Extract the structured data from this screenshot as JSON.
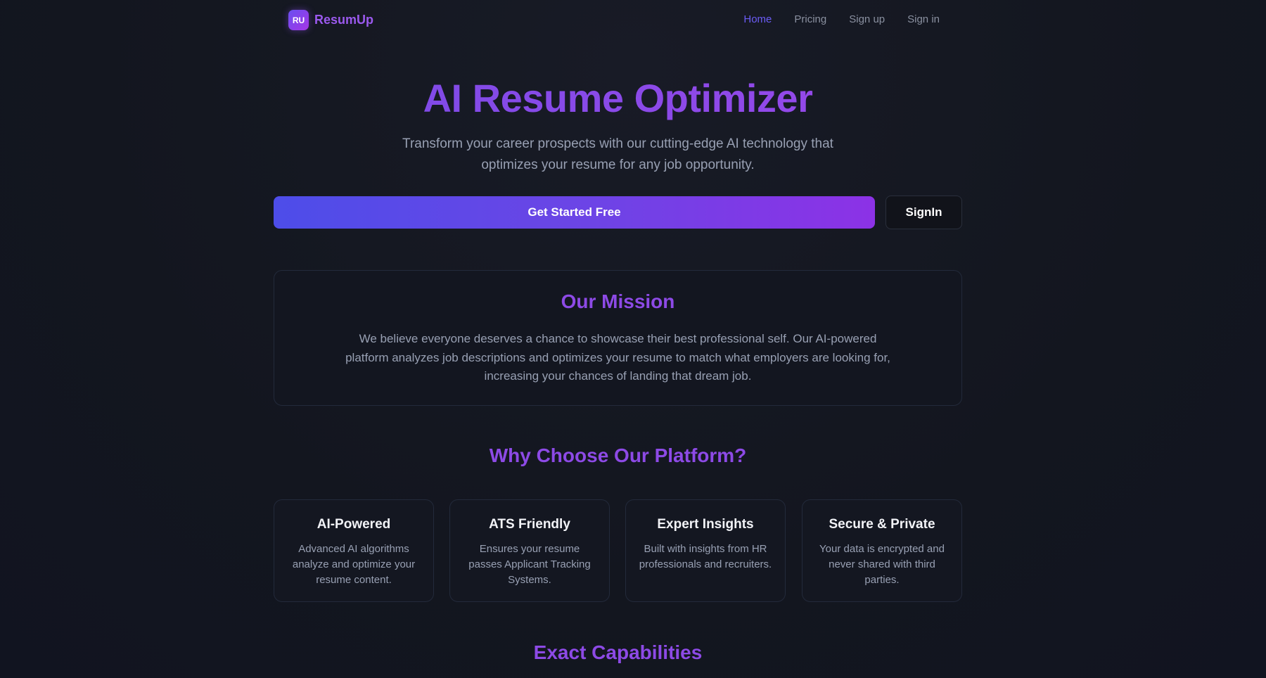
{
  "nav": {
    "logo_badge": "RU",
    "logo_text": "ResumUp",
    "links": [
      {
        "label": "Home",
        "active": true
      },
      {
        "label": "Pricing",
        "active": false
      },
      {
        "label": "Sign up",
        "active": false
      },
      {
        "label": "Sign in",
        "active": false
      }
    ]
  },
  "hero": {
    "title": "AI Resume Optimizer",
    "subtitle": "Transform your career prospects with our cutting-edge AI technology that optimizes your resume for any job opportunity.",
    "primary_button": "Get Started Free",
    "secondary_button": "SignIn"
  },
  "mission": {
    "title": "Our Mission",
    "text": "We believe everyone deserves a chance to showcase their best professional self. Our AI-powered platform analyzes job descriptions and optimizes your resume to match what employers are looking for, increasing your chances of landing that dream job."
  },
  "why": {
    "title": "Why Choose Our Platform?",
    "features": [
      {
        "title": "AI-Powered",
        "desc": "Advanced AI algorithms analyze and optimize your resume content."
      },
      {
        "title": "ATS Friendly",
        "desc": "Ensures your resume passes Applicant Tracking Systems."
      },
      {
        "title": "Expert Insights",
        "desc": "Built with insights from HR professionals and recruiters."
      },
      {
        "title": "Secure & Private",
        "desc": "Your data is encrypted and never shared with third parties."
      }
    ]
  },
  "capabilities": {
    "title": "Exact Capabilities"
  },
  "colors": {
    "accent": "#8d4ae6",
    "nav_active": "#6b5cf5",
    "background": "#13161f"
  }
}
